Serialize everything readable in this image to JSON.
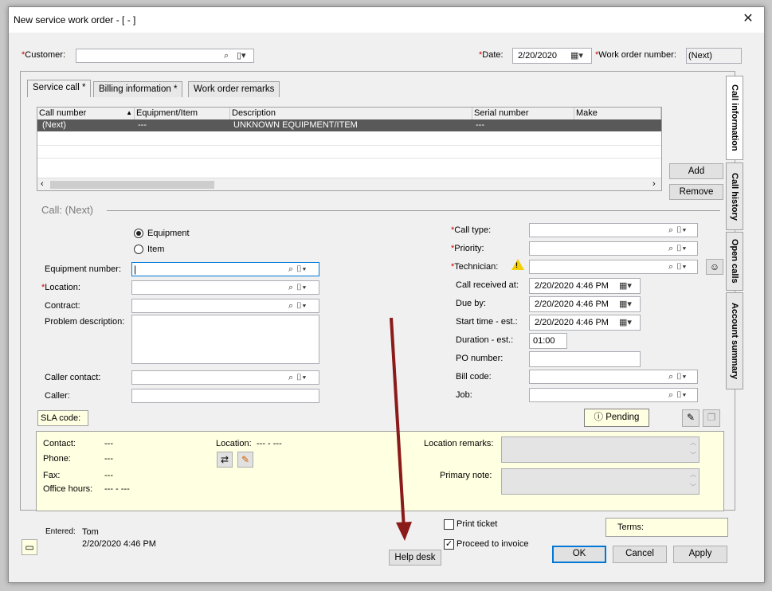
{
  "window": {
    "title": "New service work order - [ - ]",
    "close": "✕"
  },
  "header": {
    "customer_label": "Customer:",
    "customer_value": "",
    "date_label": "Date:",
    "date_value": "2/20/2020",
    "wo_label": "Work order number:",
    "wo_value": "(Next)"
  },
  "tabs": [
    "Service call *",
    "Billing information *",
    "Work order remarks"
  ],
  "side_tabs": [
    "Call information",
    "Call history",
    "Open calls",
    "Account summary"
  ],
  "grid": {
    "columns": [
      "Call number",
      "Equipment/Item",
      "Description",
      "Serial number",
      "Make"
    ],
    "rows": [
      [
        "(Next)",
        "---",
        "UNKNOWN EQUIPMENT/ITEM",
        "---",
        ""
      ]
    ]
  },
  "buttons": {
    "add": "Add",
    "remove": "Remove",
    "pending": "Pending",
    "ok": "OK",
    "cancel": "Cancel",
    "apply": "Apply",
    "help_desk": "Help desk"
  },
  "call": {
    "heading": "Call: (Next)",
    "radio_equipment": "Equipment",
    "radio_item": "Item",
    "equipment_number": "Equipment number:",
    "location": "Location:",
    "contract": "Contract:",
    "problem": "Problem description:",
    "caller_contact": "Caller contact:",
    "caller": "Caller:",
    "sla": "SLA code:",
    "call_type": "Call type:",
    "priority": "Priority:",
    "technician": "Technician:",
    "call_received": "Call received at:",
    "call_received_value": "2/20/2020   4:46 PM",
    "due_by": "Due by:",
    "due_by_value": "2/20/2020   4:46 PM",
    "start_time": "Start time - est.:",
    "start_time_value": "2/20/2020   4:46 PM",
    "duration": "Duration - est.:",
    "duration_value": "01:00",
    "po_number": "PO number:",
    "bill_code": "Bill code:",
    "job": "Job:"
  },
  "info": {
    "contact_label": "Contact:",
    "contact_value": "---",
    "phone_label": "Phone:",
    "phone_value": "---",
    "fax_label": "Fax:",
    "fax_value": "---",
    "hours_label": "Office hours:",
    "hours_value": "--- - ---",
    "location_label": "Location:",
    "location_value": "--- - ---",
    "location_remarks": "Location remarks:",
    "primary_note": "Primary note:"
  },
  "footer": {
    "entered_label": "Entered:",
    "entered_by": "Tom",
    "entered_at": "2/20/2020 4:46 PM",
    "print_ticket": "Print ticket",
    "proceed_invoice": "Proceed to invoice",
    "terms": "Terms:"
  },
  "colors": {
    "accent": "#0078d7",
    "required": "#d00000",
    "note_bg": "#ffffe1",
    "arrow": "#8b1a1a",
    "selected_row": "#595959"
  }
}
